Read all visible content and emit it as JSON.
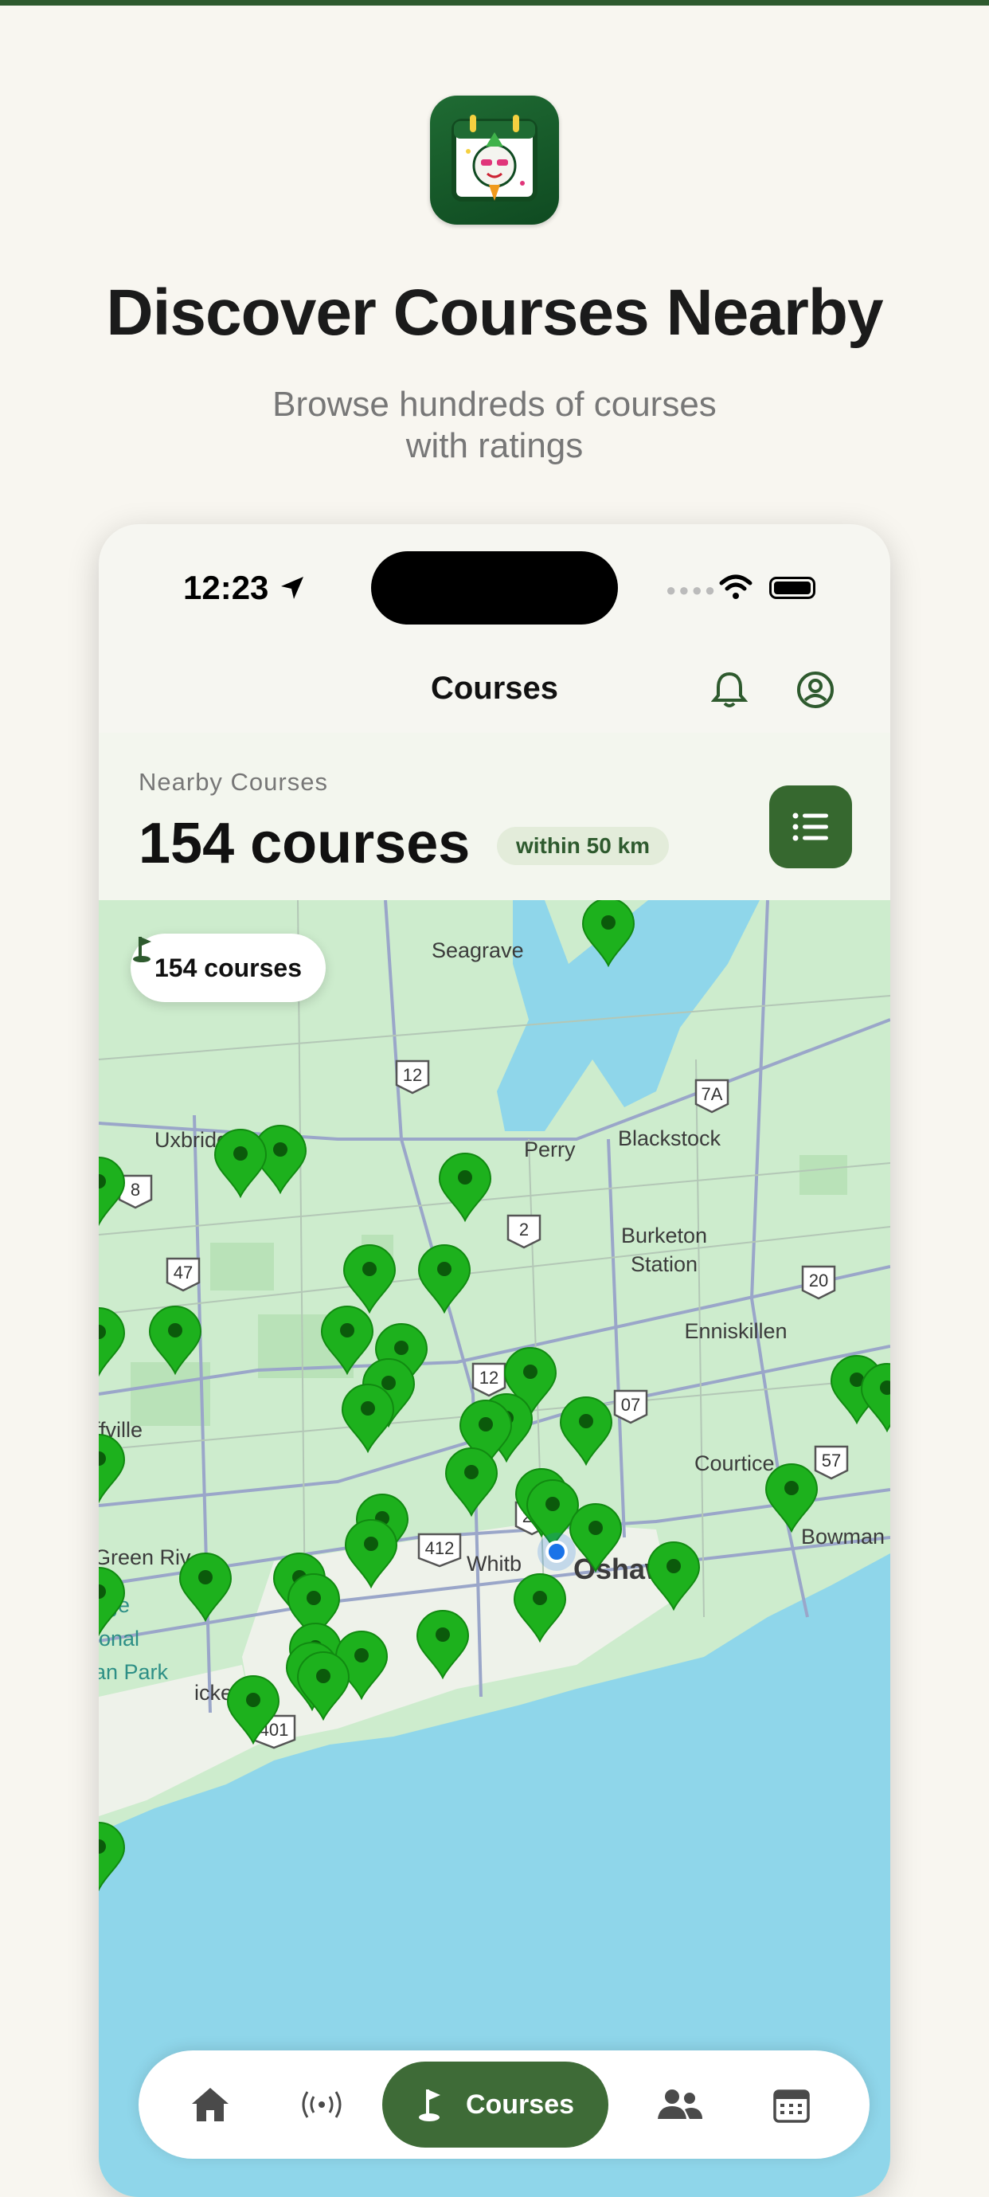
{
  "promo": {
    "headline": "Discover Courses Nearby",
    "subtitle_line1": "Browse hundreds of courses",
    "subtitle_line2": "with ratings"
  },
  "status_bar": {
    "time": "12:23"
  },
  "nav": {
    "title": "Courses"
  },
  "summary": {
    "label": "Nearby Courses",
    "count": "154 courses",
    "radius": "within 50 km"
  },
  "map": {
    "chip_label": "154 courses",
    "place_labels": [
      "Seagrave",
      "Perry",
      "Blackstock",
      "Burketon",
      "Station",
      "Enniskillen",
      "Oshawa",
      "Whitb",
      "Bowman",
      "Green Riv",
      "ffville",
      "Uxbridge",
      "ickering",
      "Courtice",
      "uge",
      "ional",
      "an Park"
    ],
    "route_labels": [
      "12",
      "7A",
      "8",
      "2",
      "47",
      "20",
      "12",
      "57",
      "26",
      "412",
      "401",
      "07"
    ]
  },
  "bottom_nav": {
    "items": [
      "home",
      "live",
      "Courses",
      "friends",
      "calendar"
    ],
    "active_label": "Courses"
  },
  "colors": {
    "accent": "#3e6b37",
    "pin": "#1db11d",
    "water": "#8fd6ea",
    "land": "#cdeccd"
  }
}
